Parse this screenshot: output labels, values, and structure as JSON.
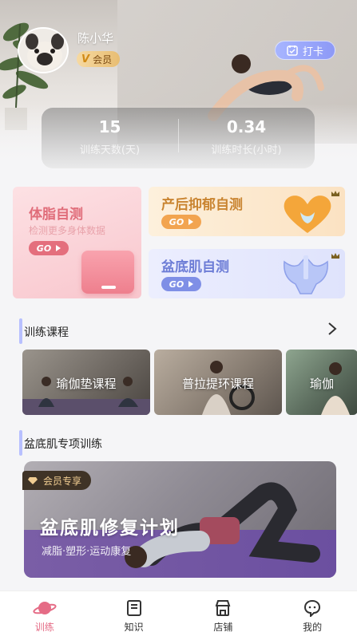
{
  "user": {
    "name": "陈小华",
    "vip_label": "会员",
    "checkin_label": "打卡"
  },
  "stats": [
    {
      "value": "15",
      "label": "训练天数(天)"
    },
    {
      "value": "0.34",
      "label": "训练时长(小时)"
    }
  ],
  "tests": {
    "body_fat": {
      "title": "体脂自测",
      "subtitle": "检测更多身体数据",
      "go": "GO"
    },
    "postpartum": {
      "title": "产后抑郁自测",
      "go": "GO"
    },
    "pelvic": {
      "title": "盆底肌自测",
      "go": "GO"
    }
  },
  "courses_section": {
    "title": "训练课程",
    "more_icon": "chevron-right-icon",
    "items": [
      {
        "label": "瑜伽垫课程"
      },
      {
        "label": "普拉提环课程"
      },
      {
        "label": "瑜伽"
      }
    ]
  },
  "pelvic_section": {
    "title": "盆底肌专项训练",
    "badge": "会员专享",
    "banner_title": "盆底肌修复计划",
    "banner_subtitle": "减脂·塑形·运动康复"
  },
  "tabbar": [
    {
      "label": "训练",
      "icon": "planet-icon",
      "active": true
    },
    {
      "label": "知识",
      "icon": "book-icon",
      "active": false
    },
    {
      "label": "店铺",
      "icon": "store-icon",
      "active": false
    },
    {
      "label": "我的",
      "icon": "profile-chat-icon",
      "active": false
    }
  ],
  "colors": {
    "accent": "#e56c86",
    "checkin": "#8d99f6",
    "fat_card": "#f8c6cd",
    "post_card": "#fbe2c2",
    "pelvic_card": "#dfe3fc"
  }
}
